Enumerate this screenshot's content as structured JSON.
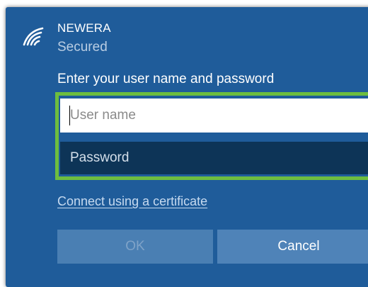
{
  "network": {
    "name": "NEWERA",
    "status": "Secured",
    "icon": "wifi-secured-icon"
  },
  "login": {
    "prompt": "Enter your user name and password",
    "username_placeholder": "User name",
    "password_placeholder": "Password",
    "certificate_link": "Connect using a certificate"
  },
  "buttons": {
    "ok": "OK",
    "cancel": "Cancel"
  },
  "colors": {
    "panel": "#1f5c9a",
    "highlight": "#6dbd3f",
    "password_field": "#0d3457"
  }
}
